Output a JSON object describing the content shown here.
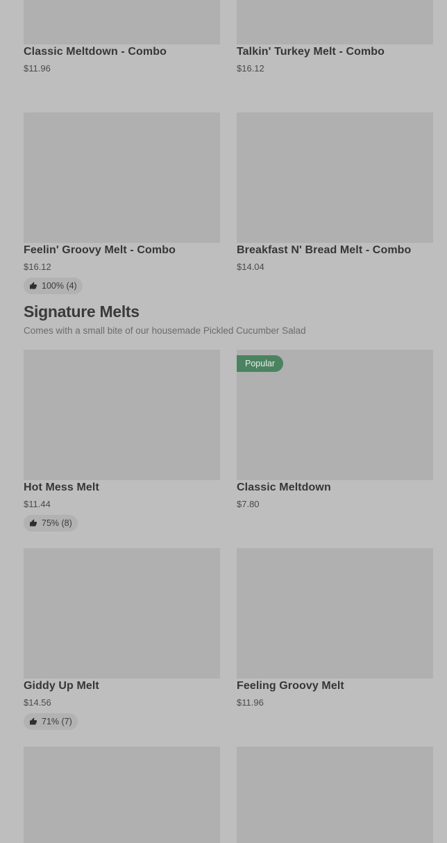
{
  "combos": {
    "items": [
      {
        "name": "Classic Meltdown - Combo",
        "price": "$11.96"
      },
      {
        "name": "Talkin' Turkey Melt - Combo",
        "price": "$16.12"
      },
      {
        "name": "Feelin' Groovy Melt - Combo",
        "price": "$16.12",
        "rating": "100% (4)"
      },
      {
        "name": "Breakfast N' Bread Melt - Combo",
        "price": "$14.04"
      }
    ]
  },
  "signature": {
    "title": "Signature Melts",
    "subtitle": "Comes with a small bite of our housemade Pickled Cucumber Salad",
    "items": [
      {
        "name": "Hot Mess Melt",
        "price": "$11.44",
        "rating": "75% (8)"
      },
      {
        "name": "Classic Meltdown",
        "price": "$7.80",
        "badge": "Popular"
      },
      {
        "name": "Giddy Up Melt",
        "price": "$14.56",
        "rating": "71% (7)"
      },
      {
        "name": "Feeling Groovy Melt",
        "price": "$11.96"
      }
    ]
  },
  "colors": {
    "background": "#bebebe",
    "image_placeholder": "#b0b0b0",
    "popular_badge": "#4b8360"
  },
  "icons": {
    "rating": "thumbs-up-icon"
  }
}
